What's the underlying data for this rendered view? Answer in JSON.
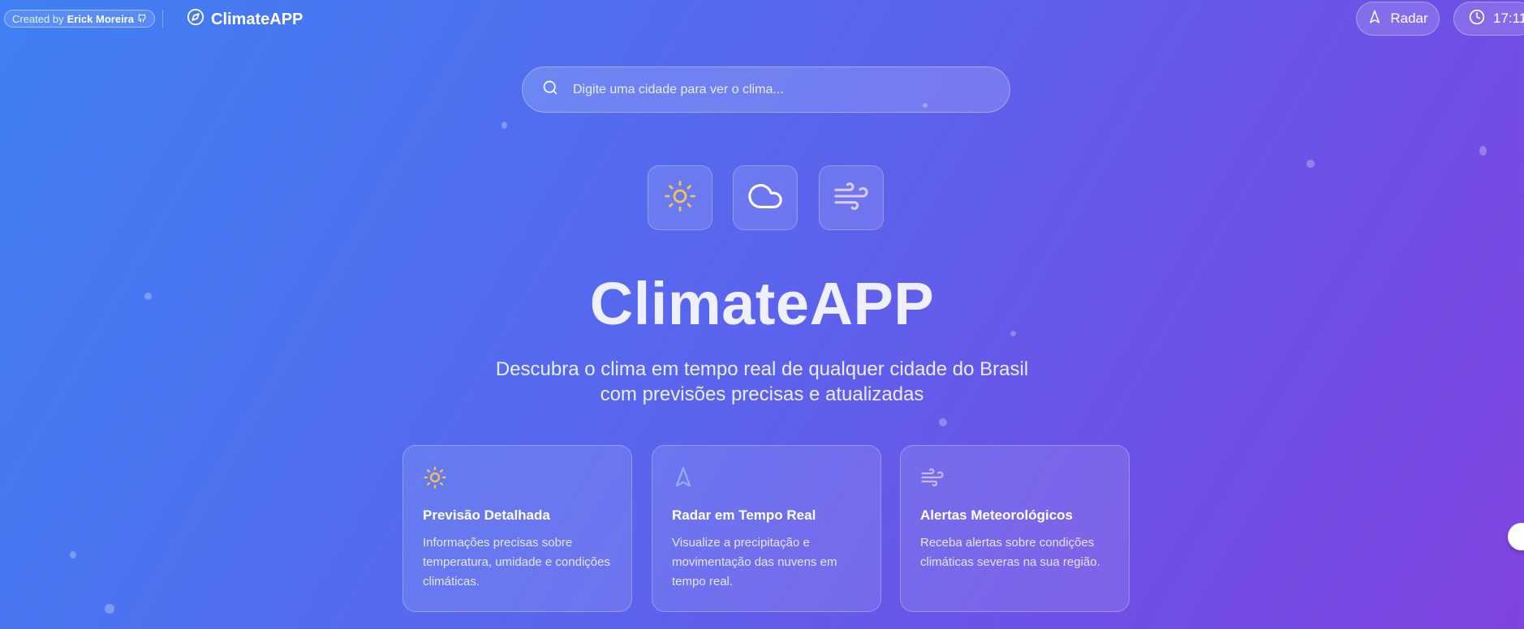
{
  "header": {
    "credit_prefix": "Created by",
    "credit_author": "Erick Moreira",
    "brand_name": "ClimateAPP",
    "radar_label": "Radar",
    "time": "17:11"
  },
  "search": {
    "placeholder": "Digite uma cidade para ver o clima..."
  },
  "weather_tiles": [
    {
      "icon": "sun-icon"
    },
    {
      "icon": "cloud-icon"
    },
    {
      "icon": "wind-icon"
    }
  ],
  "hero": {
    "title": "ClimateAPP",
    "subtitle_line1": "Descubra o clima em tempo real de qualquer cidade do Brasil",
    "subtitle_line2": "com previsões precisas e atualizadas"
  },
  "features": [
    {
      "icon": "sun-icon",
      "title": "Previsão Detalhada",
      "description": "Informações precisas sobre temperatura, umidade e condições climáticas."
    },
    {
      "icon": "navigation-arrow-icon",
      "title": "Radar em Tempo Real",
      "description": "Visualize a precipitação e movimentação das nuvens em tempo real."
    },
    {
      "icon": "wind-icon",
      "title": "Alertas Meteorológicos",
      "description": "Receba alertas sobre condições climáticas severas na sua região."
    }
  ],
  "colors": {
    "gradient_start": "#3f80f4",
    "gradient_end": "#7f44e2",
    "sun_yellow": "#f5c451",
    "nav_blue": "#8fb4ff",
    "wind_lilac": "#c9b8f5"
  }
}
